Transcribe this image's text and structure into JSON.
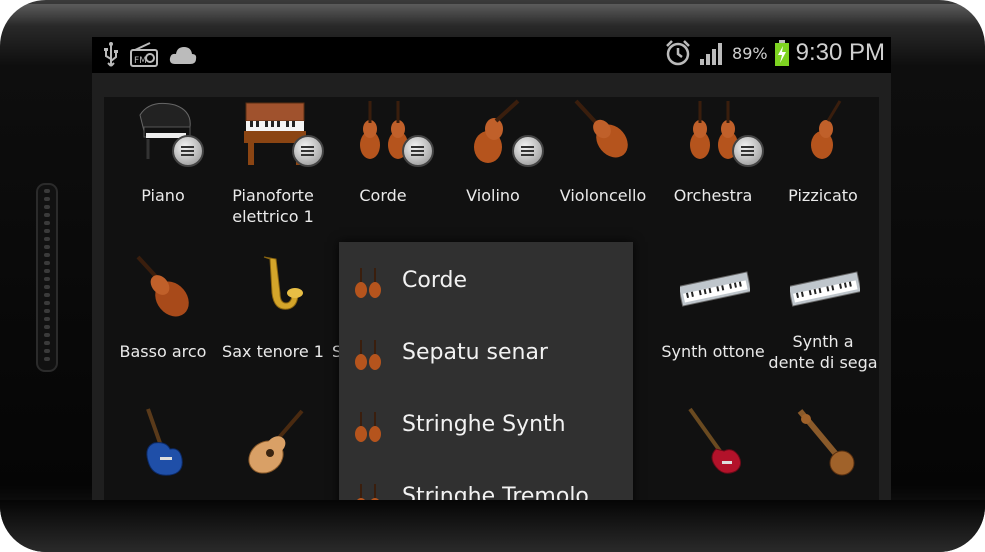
{
  "status_bar": {
    "battery_percent": "89%",
    "time": "9:30 PM",
    "icons": [
      "usb-icon",
      "radio-icon",
      "cloud-icon",
      "alarm-icon",
      "signal-icon",
      "battery-charging-icon"
    ]
  },
  "grid": {
    "row1": [
      {
        "label": "Piano",
        "icon": "grand-piano-icon",
        "badge": true
      },
      {
        "label": "Pianoforte elettrico 1",
        "icon": "electric-piano-icon",
        "badge": true
      },
      {
        "label": "Corde",
        "icon": "violins-icon",
        "badge": true
      },
      {
        "label": "Violino",
        "icon": "violin-icon",
        "badge": true
      },
      {
        "label": "Violoncello",
        "icon": "cello-icon",
        "badge": false
      },
      {
        "label": "Orchestra",
        "icon": "violins-icon",
        "badge": true
      },
      {
        "label": "Pizzicato",
        "icon": "violin-icon",
        "badge": false
      }
    ],
    "row2": [
      {
        "label": "Basso arco",
        "icon": "double-bass-icon"
      },
      {
        "label": "Sax tenore 1",
        "icon": "saxophone-icon"
      },
      {
        "label": "S",
        "icon": "hidden-icon"
      },
      {
        "label": "Synth ottone",
        "icon": "synth-keyboard-icon"
      },
      {
        "label": "Synth a dente di sega",
        "icon": "synth-keyboard-icon"
      }
    ],
    "row3": [
      {
        "label": "",
        "icon": "electric-guitar-icon"
      },
      {
        "label": "",
        "icon": "acoustic-guitar-icon"
      },
      {
        "label": "",
        "icon": "electric-bass-icon"
      },
      {
        "label": "",
        "icon": "sitar-icon"
      }
    ]
  },
  "popup": {
    "items": [
      {
        "label": "Corde",
        "icon": "violins-icon"
      },
      {
        "label": "Sepatu senar",
        "icon": "violins-icon"
      },
      {
        "label": "Stringhe Synth",
        "icon": "violins-icon"
      },
      {
        "label": "Stringhe Tremolo",
        "icon": "violins-icon"
      }
    ]
  }
}
